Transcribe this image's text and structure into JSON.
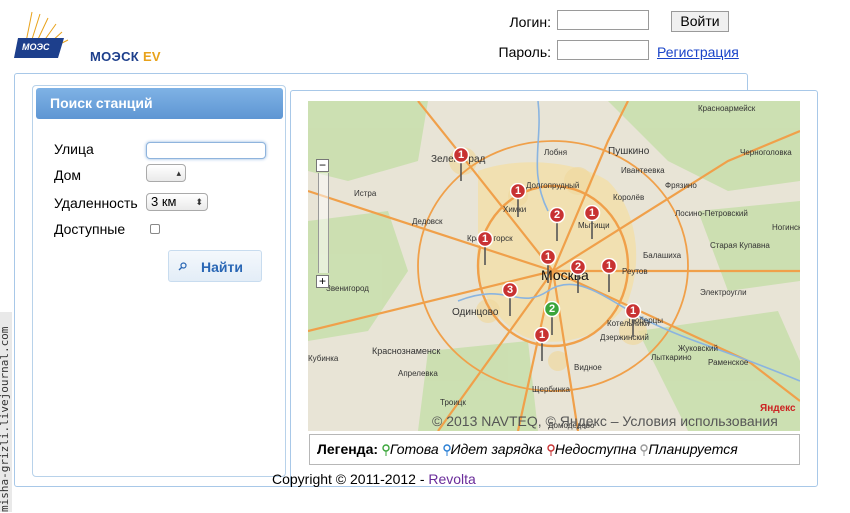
{
  "watermark": "misha-grizli.livejournal.com",
  "logo": {
    "brand": "МОЭСК",
    "suffix": "EV",
    "badge": "МОЭС"
  },
  "login": {
    "login_label": "Логин:",
    "password_label": "Пароль:",
    "submit_label": "Войти",
    "register_label": "Регистрация"
  },
  "search": {
    "title": "Поиск станций",
    "street_label": "Улица",
    "house_label": "Дом",
    "distance_label": "Удаленность",
    "distance_value": "3 км",
    "available_label": "Доступные",
    "find_label": "Найти"
  },
  "map": {
    "copyright": "© 2013 NAVTEQ, © Яндекс – Условия использования",
    "brand": "Яндекс",
    "cities": [
      {
        "name": "Истрa"
      },
      {
        "name": "Зеленоград"
      },
      {
        "name": "Долгопрудный"
      },
      {
        "name": "Химки"
      },
      {
        "name": "Лобня"
      },
      {
        "name": "Пушкино"
      },
      {
        "name": "Королёв"
      },
      {
        "name": "Мытищи"
      },
      {
        "name": "Фрязино"
      },
      {
        "name": "Лосино-Петровский"
      },
      {
        "name": "Красногорск"
      },
      {
        "name": "Москва"
      },
      {
        "name": "Реутов"
      },
      {
        "name": "Балашиха"
      },
      {
        "name": "Одинцово"
      },
      {
        "name": "Люберцы"
      },
      {
        "name": "Котельники"
      },
      {
        "name": "Дзержинский"
      },
      {
        "name": "Лыткарино"
      },
      {
        "name": "Видное"
      },
      {
        "name": "Раменское"
      },
      {
        "name": "Краснознаменск"
      },
      {
        "name": "Апрелевка"
      },
      {
        "name": "Троицк"
      },
      {
        "name": "Щербинка"
      },
      {
        "name": "Домодедово"
      },
      {
        "name": "Дедовск"
      },
      {
        "name": "Черноголовка"
      },
      {
        "name": "Электроугли"
      },
      {
        "name": "Старая Купавна"
      },
      {
        "name": "Жуковский"
      },
      {
        "name": "Ивантеевка"
      },
      {
        "name": "Кубинка"
      },
      {
        "name": "Звенигород"
      },
      {
        "name": "Ногинск"
      },
      {
        "name": "Красноармейск"
      }
    ],
    "markers": [
      {
        "num": "1",
        "status": "unavailable"
      },
      {
        "num": "1",
        "status": "unavailable"
      },
      {
        "num": "2",
        "status": "unavailable"
      },
      {
        "num": "1",
        "status": "unavailable"
      },
      {
        "num": "1",
        "status": "unavailable"
      },
      {
        "num": "1",
        "status": "unavailable"
      },
      {
        "num": "2",
        "status": "unavailable"
      },
      {
        "num": "1",
        "status": "unavailable"
      },
      {
        "num": "3",
        "status": "unavailable"
      },
      {
        "num": "2",
        "status": "ready"
      },
      {
        "num": "1",
        "status": "unavailable"
      },
      {
        "num": "1",
        "status": "unavailable"
      }
    ]
  },
  "legend": {
    "title": "Легенда:",
    "ready": "Готова",
    "charging": "Идет зарядка",
    "unavailable": "Недоступна",
    "planned": "Планируется"
  },
  "colors": {
    "ready": "#3aa53a",
    "charging": "#2a7fd4",
    "unavailable": "#c83232",
    "planned": "#999999",
    "accent": "#5e96d3"
  },
  "footer": {
    "copyright": "Copyright © 2011-2012 - ",
    "link": "Revolta"
  }
}
